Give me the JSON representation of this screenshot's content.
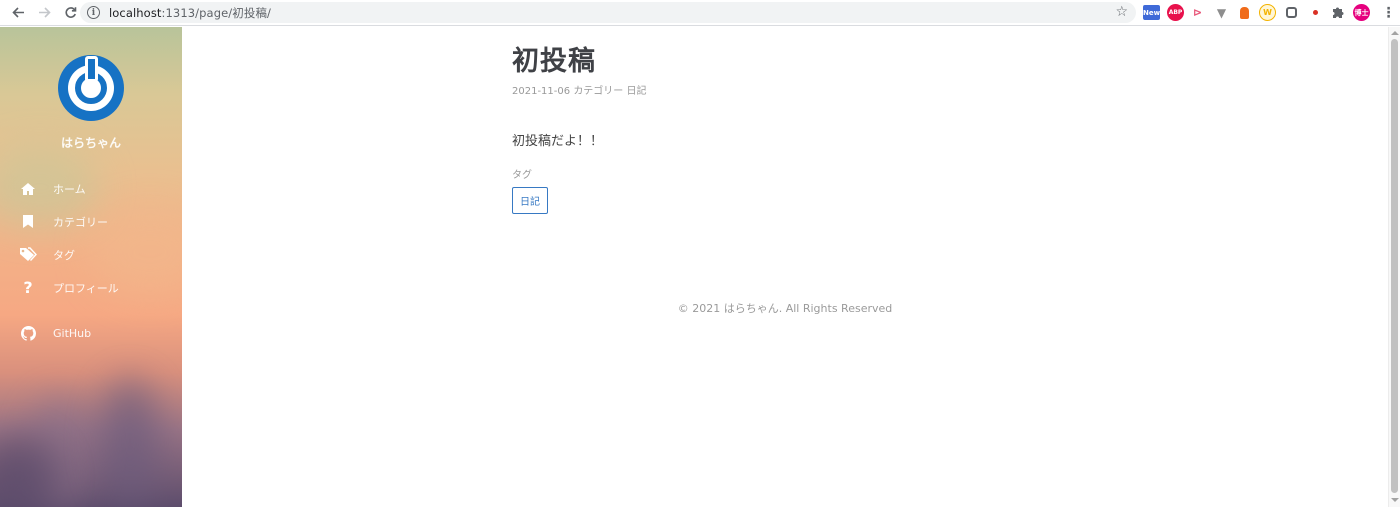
{
  "browser": {
    "url_host": "localhost",
    "url_rest": ":1313/page/初投稿/",
    "extensions": [
      {
        "name": "new-extension-icon",
        "label": "New",
        "color": "#3f6ad8"
      },
      {
        "name": "adblock-icon",
        "label": "ABP",
        "color": "#e8114c"
      },
      {
        "name": "cast-extension-icon",
        "label": "",
        "color": "#e8587a"
      },
      {
        "name": "vivaldi-extension-icon",
        "label": "",
        "color": "#8e8e8e"
      },
      {
        "name": "fire-extension-icon",
        "label": "",
        "color": "#f06b1a"
      },
      {
        "name": "w-extension-icon",
        "label": "W",
        "color": "#f3b300"
      },
      {
        "name": "box-extension-icon",
        "label": "",
        "color": "#5f6368"
      },
      {
        "name": "dot-extension-icon",
        "label": "",
        "color": "#d93025"
      },
      {
        "name": "puzzle-icon",
        "label": "",
        "color": "#5f6368"
      },
      {
        "name": "profile-avatar",
        "label": "博士",
        "color": "#e6007e"
      }
    ]
  },
  "sidebar": {
    "site_name": "はらちゃん",
    "menu": [
      {
        "name": "menu-item-home",
        "icon": "home-icon",
        "label": "ホーム"
      },
      {
        "name": "menu-item-category",
        "icon": "bookmark-icon",
        "label": "カテゴリー"
      },
      {
        "name": "menu-item-tag",
        "icon": "tags-icon",
        "label": "タグ"
      },
      {
        "name": "menu-item-profile",
        "icon": "question-icon",
        "label": "プロフィール"
      },
      {
        "name": "menu-item-github",
        "icon": "github-icon",
        "label": "GitHub"
      }
    ]
  },
  "article": {
    "title": "初投稿",
    "date": "2021-11-06",
    "category_label": "カテゴリー",
    "category": "日記",
    "body": "初投稿だよ！！",
    "tags_label": "タグ",
    "tags": [
      "日記"
    ]
  },
  "footer": {
    "text": "© 2021 はらちゃん. All Rights Reserved"
  }
}
